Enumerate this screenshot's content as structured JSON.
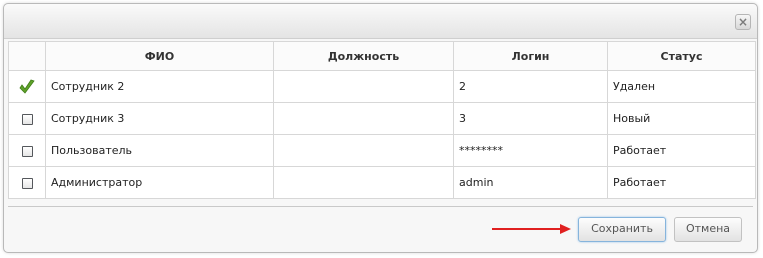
{
  "dialog": {
    "close_glyph": "×"
  },
  "table": {
    "columns": [
      "",
      "ФИО",
      "Должность",
      "Логин",
      "Статус"
    ],
    "rows": [
      {
        "checked": true,
        "name": "Сотрудник 2",
        "position": "",
        "login": "2",
        "status": "Удален"
      },
      {
        "checked": false,
        "name": "Сотрудник 3",
        "position": "",
        "login": "3",
        "status": "Новый"
      },
      {
        "checked": false,
        "name": "Пользователь",
        "position": "",
        "login": "********",
        "status": "Работает"
      },
      {
        "checked": false,
        "name": "Администратор",
        "position": "",
        "login": "admin",
        "status": "Работает"
      }
    ]
  },
  "footer": {
    "save_label": "Сохранить",
    "cancel_label": "Отмена"
  },
  "colors": {
    "checkmark": "#5fa22a",
    "arrow": "#e02020",
    "save_border": "#86b4dc"
  },
  "icons": {
    "selected": "checkmark-icon",
    "unselected": "checkbox-icon",
    "close": "close-icon",
    "annotation": "red-arrow"
  }
}
